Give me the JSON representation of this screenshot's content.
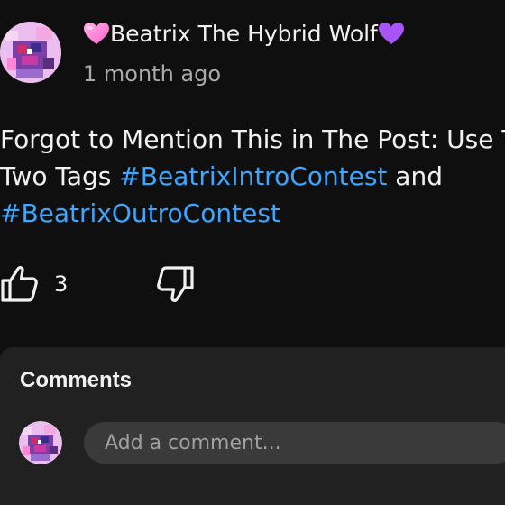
{
  "post": {
    "author": {
      "name": "Beatrix The Hybrid Wolf",
      "prefix_emoji": "pink-heart",
      "suffix_emoji": "purple-heart"
    },
    "timestamp": "1 month ago",
    "body": {
      "line1": "Forgot to Mention This in The Post: Use The",
      "line2_prefix": "Two Tags ",
      "hashtag1": "#BeatrixIntroContest",
      "line2_suffix": " and",
      "hashtag2": "#BeatrixOutroContest"
    },
    "actions": {
      "like_icon": "thumbs-up-icon",
      "like_count": "3",
      "dislike_icon": "thumbs-down-icon"
    }
  },
  "comments": {
    "title": "Comments",
    "input_placeholder": "Add a comment..."
  },
  "colors": {
    "background": "#0f0f0f",
    "text": "#f1f1f1",
    "secondary_text": "#aaaaaa",
    "hashtag": "#3ea6ff",
    "panel": "#212121",
    "input": "#3a3a3a",
    "pink_heart": "#ff7ad9",
    "purple_heart": "#a855f7"
  }
}
